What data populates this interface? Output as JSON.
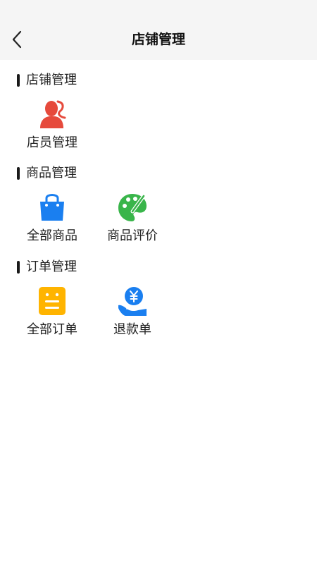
{
  "header": {
    "title": "店铺管理",
    "back_icon": "chevron-left-icon"
  },
  "sections": [
    {
      "title": "店铺管理",
      "items": [
        {
          "label": "店员管理",
          "icon": "staff-icon",
          "color": "#e64a3c"
        }
      ]
    },
    {
      "title": "商品管理",
      "items": [
        {
          "label": "全部商品",
          "icon": "shopping-bag-icon",
          "color": "#1a7ff0"
        },
        {
          "label": "商品评价",
          "icon": "palette-icon",
          "color": "#39b54a"
        }
      ]
    },
    {
      "title": "订单管理",
      "items": [
        {
          "label": "全部订单",
          "icon": "order-list-icon",
          "color": "#ffb400"
        },
        {
          "label": "退款单",
          "icon": "refund-yen-icon",
          "color": "#1a7ff0"
        }
      ]
    }
  ]
}
